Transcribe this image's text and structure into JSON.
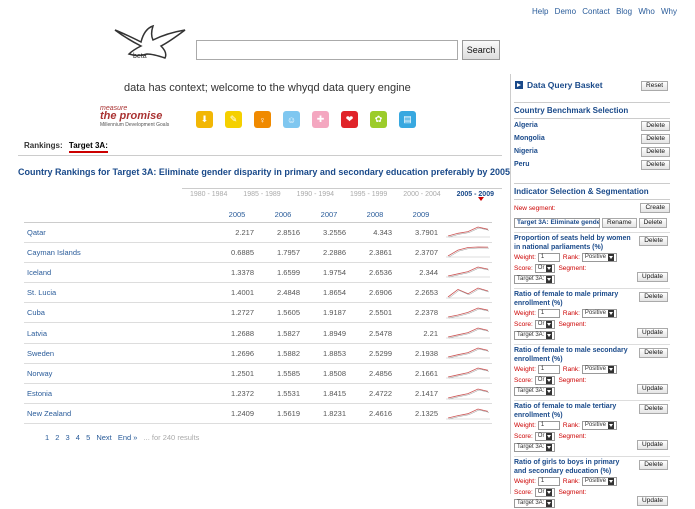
{
  "topnav": [
    "Help",
    "Demo",
    "Contact",
    "Blog",
    "Who",
    "Why"
  ],
  "logo": {
    "label": "beta"
  },
  "search": {
    "value": "",
    "button": "Search"
  },
  "tagline": "data has context; welcome to the whyqd data query engine",
  "mdg": {
    "measure": "measure",
    "promise": "the promise",
    "sub": "Millennium Development Goals"
  },
  "goal_icons": [
    {
      "name": "goal-1-icon",
      "color": "#f2b705",
      "glyph": "⬇"
    },
    {
      "name": "goal-2-icon",
      "color": "#f5d000",
      "glyph": "✎"
    },
    {
      "name": "goal-3-icon",
      "color": "#f08a00",
      "glyph": "♀"
    },
    {
      "name": "goal-4-icon",
      "color": "#7fc7f0",
      "glyph": "☺"
    },
    {
      "name": "goal-5-icon",
      "color": "#f4a7c0",
      "glyph": "✚"
    },
    {
      "name": "goal-6-icon",
      "color": "#e0242a",
      "glyph": "❤"
    },
    {
      "name": "goal-7-icon",
      "color": "#9ccc2a",
      "glyph": "✿"
    },
    {
      "name": "goal-8-icon",
      "color": "#38a8e0",
      "glyph": "▤"
    }
  ],
  "rankings": {
    "label": "Rankings:",
    "target": "Target 3A:"
  },
  "page_title": "Country Rankings for Target 3A: Eliminate gender disparity in primary and secondary education preferably by 2005",
  "periods": [
    "1980 - 1984",
    "1985 - 1989",
    "1990 - 1994",
    "1995 - 1999",
    "2000 - 2004",
    "2005 - 2009"
  ],
  "active_period": "2005 - 2009",
  "table": {
    "years": [
      "2005",
      "2006",
      "2007",
      "2008",
      "2009"
    ],
    "rows": [
      {
        "country": "Qatar",
        "values": [
          "2.217",
          "2.8516",
          "3.2556",
          "4.343",
          "3.7901"
        ]
      },
      {
        "country": "Cayman Islands",
        "values": [
          "0.6885",
          "1.7957",
          "2.2886",
          "2.3861",
          "2.3707"
        ]
      },
      {
        "country": "Iceland",
        "values": [
          "1.3378",
          "1.6599",
          "1.9754",
          "2.6536",
          "2.344"
        ]
      },
      {
        "country": "St. Lucia",
        "values": [
          "1.4001",
          "2.4848",
          "1.8654",
          "2.6906",
          "2.2653"
        ]
      },
      {
        "country": "Cuba",
        "values": [
          "1.2727",
          "1.5605",
          "1.9187",
          "2.5501",
          "2.2378"
        ]
      },
      {
        "country": "Latvia",
        "values": [
          "1.2688",
          "1.5827",
          "1.8949",
          "2.5478",
          "2.21"
        ]
      },
      {
        "country": "Sweden",
        "values": [
          "1.2696",
          "1.5882",
          "1.8853",
          "2.5299",
          "2.1938"
        ]
      },
      {
        "country": "Norway",
        "values": [
          "1.2501",
          "1.5585",
          "1.8508",
          "2.4856",
          "2.1661"
        ]
      },
      {
        "country": "Estonia",
        "values": [
          "1.2372",
          "1.5531",
          "1.8415",
          "2.4722",
          "2.1417"
        ]
      },
      {
        "country": "New Zealand",
        "values": [
          "1.2409",
          "1.5619",
          "1.8231",
          "2.4616",
          "2.1325"
        ]
      }
    ]
  },
  "pager": {
    "pages": [
      "1",
      "2",
      "3",
      "4",
      "5"
    ],
    "next": "Next",
    "end": "End »",
    "results": "... for 240 results"
  },
  "sidebar": {
    "title": "Data Query Basket",
    "reset": "Reset",
    "benchmark_title": "Country Benchmark Selection",
    "countries": [
      "Algeria",
      "Mongolia",
      "Nigeria",
      "Peru"
    ],
    "delete": "Delete",
    "indicator_title": "Indicator Selection & Segmentation",
    "new_segment": "New segment:",
    "create": "Create",
    "segment_value": "Target 3A: Eliminate gende",
    "rename": "Rename",
    "update": "Update",
    "weight_label": "Weight:",
    "rank_label": "Rank:",
    "score_label": "Score:",
    "segment_label": "Segment:",
    "indicators": [
      {
        "title": "Proportion of seats held by women in national parliaments (%)",
        "weight": "1",
        "rank": "Positive",
        "score": "Or",
        "segment": "Target 3A:"
      },
      {
        "title": "Ratio of female to male primary enrollment (%)",
        "weight": "1",
        "rank": "Positive",
        "score": "Or",
        "segment": "Target 3A:"
      },
      {
        "title": "Ratio of female to male secondary enrollment (%)",
        "weight": "1",
        "rank": "Positive",
        "score": "Or",
        "segment": "Target 3A:"
      },
      {
        "title": "Ratio of female to male tertiary enrollment (%)",
        "weight": "1",
        "rank": "Positive",
        "score": "Or",
        "segment": "Target 3A:"
      },
      {
        "title": "Ratio of girls to boys in primary and secondary education (%)",
        "weight": "1",
        "rank": "Positive",
        "score": "Or",
        "segment": "Target 3A:"
      }
    ]
  }
}
